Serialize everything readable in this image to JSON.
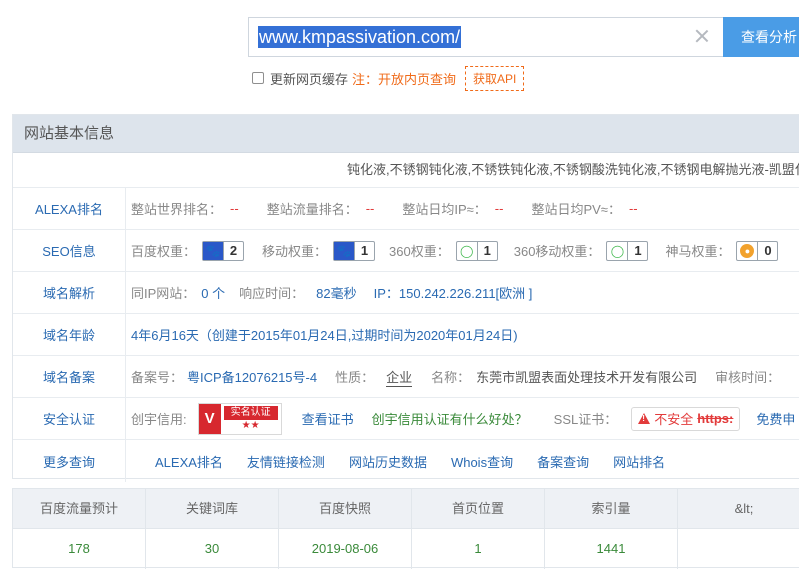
{
  "search": {
    "url": "www.kmpassivation.com/",
    "query_label": "查看分析"
  },
  "options": {
    "refresh_cache_label": "更新网页缓存",
    "note": "注：开放内页查询",
    "api_label": "获取API"
  },
  "panel": {
    "title": "网站基本信息",
    "description": "钝化液,不锈钢钝化液,不锈铁钝化液,不锈钢酸洗钝化液,不锈钢电解抛光液-凯盟化"
  },
  "alexa": {
    "label": "ALEXA排名",
    "world_rank_label": "整站世界排名：",
    "world_rank": "--",
    "traffic_rank_label": "整站流量排名：",
    "traffic_rank": "--",
    "daily_ip_label": "整站日均IP≈：",
    "daily_ip": "--",
    "daily_pv_label": "整站日均PV≈：",
    "daily_pv": "--"
  },
  "seo": {
    "label": "SEO信息",
    "items": [
      {
        "label": "百度权重：",
        "icon": "paw-icon",
        "value": "2"
      },
      {
        "label": "移动权重：",
        "icon": "paw-icon",
        "value": "1"
      },
      {
        "label": "360权重：",
        "icon": "360-icon",
        "value": "1"
      },
      {
        "label": "360移动权重：",
        "icon": "360-icon",
        "value": "1"
      },
      {
        "label": "神马权重：",
        "icon": "shenma-icon",
        "value": "0"
      }
    ]
  },
  "dns": {
    "label": "域名解析",
    "same_ip_label": "同IP网站：",
    "same_ip": "0 个",
    "response_label": "响应时间：",
    "response": "82毫秒",
    "ip_label": "IP：",
    "ip": "150.242.226.211[欧洲 ]"
  },
  "age": {
    "label": "域名年龄",
    "value": "4年6月16天（创建于2015年01月24日,过期时间为2020年01月24日)"
  },
  "icp": {
    "label": "域名备案",
    "no_label": "备案号：",
    "no": "粤ICP备12076215号-4",
    "type_label": "性质：",
    "type": "企业",
    "name_label": "名称：",
    "name": "东莞市凯盟表面处理技术开发有限公司",
    "audit_label": "审核时间："
  },
  "security": {
    "label": "安全认证",
    "credit_label": "创宇信用:",
    "cert_badge_top": "实名认证",
    "cert_badge_stars": "★★",
    "view_cert": "查看证书",
    "credit_benefit": "创宇信用认证有什么好处？",
    "ssl_label": "SSL证书：",
    "ssl_warning": "不安全",
    "ssl_proto": "https:",
    "free_label": "免费申"
  },
  "more": {
    "label": "更多查询",
    "links": [
      "ALEXA排名",
      "友情链接检测",
      "网站历史数据",
      "Whois查询",
      "备案查询",
      "网站排名"
    ]
  },
  "stats": {
    "headers": [
      "百度流量预计",
      "关键词库",
      "百度快照",
      "首页位置",
      "索引量",
      "&lt;"
    ],
    "values": [
      "178",
      "30",
      "2019-08-06",
      "1",
      "1441",
      ""
    ]
  },
  "colors": {
    "accent": "#4a9ce6",
    "link": "#2a6ab2",
    "warn": "#f06b1a",
    "danger": "#e23b3b",
    "green": "#3a8a3a"
  }
}
